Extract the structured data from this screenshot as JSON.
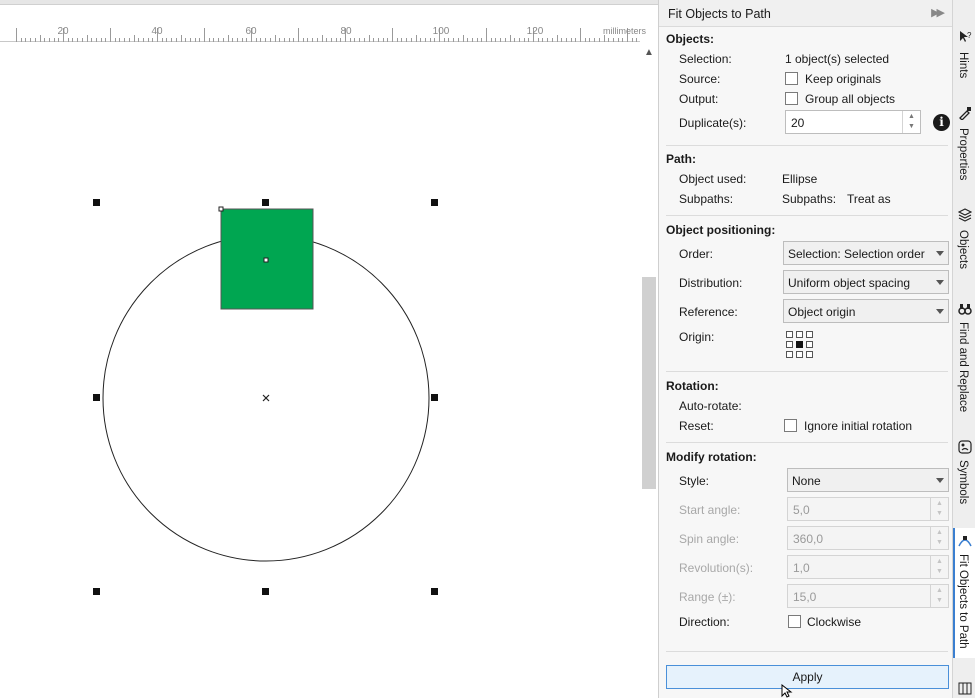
{
  "ruler": {
    "labels": [
      "20",
      "40",
      "60",
      "80",
      "100",
      "120"
    ],
    "unit": "millimeters"
  },
  "docker": {
    "title": "Fit Objects to Path",
    "objects": {
      "heading": "Objects:",
      "selection_label": "Selection:",
      "selection_value": "1 object(s) selected",
      "source_label": "Source:",
      "keep_originals": "Keep originals",
      "output_label": "Output:",
      "group_all": "Group all objects",
      "duplicates_label": "Duplicate(s):",
      "duplicates_value": "20"
    },
    "path": {
      "heading": "Path:",
      "object_used_label": "Object used:",
      "object_used_value": "Ellipse",
      "subpaths_label": "Subpaths:",
      "subpaths_value1": "Subpaths:",
      "subpaths_value2": "Treat as"
    },
    "positioning": {
      "heading": "Object positioning:",
      "order_label": "Order:",
      "order_value": "Selection: Selection order",
      "distribution_label": "Distribution:",
      "distribution_value": "Uniform object spacing",
      "reference_label": "Reference:",
      "reference_value": "Object origin",
      "origin_label": "Origin:"
    },
    "rotation": {
      "heading": "Rotation:",
      "auto_rotate_label": "Auto-rotate:",
      "reset_label": "Reset:",
      "ignore_initial": "Ignore initial rotation"
    },
    "modify_rotation": {
      "heading": "Modify rotation:",
      "style_label": "Style:",
      "style_value": "None",
      "start_angle_label": "Start angle:",
      "start_angle_value": "5,0",
      "spin_angle_label": "Spin angle:",
      "spin_angle_value": "360,0",
      "revolutions_label": "Revolution(s):",
      "revolutions_value": "1,0",
      "range_label": "Range (±):",
      "range_value": "15,0",
      "direction_label": "Direction:",
      "clockwise": "Clockwise"
    },
    "apply_label": "Apply"
  },
  "tabs": [
    {
      "label": "Hints",
      "icon": "hints-icon"
    },
    {
      "label": "Properties",
      "icon": "properties-icon"
    },
    {
      "label": "Objects",
      "icon": "layers-icon"
    },
    {
      "label": "Find and Replace",
      "icon": "binoculars-icon"
    },
    {
      "label": "Symbols",
      "icon": "symbols-icon"
    },
    {
      "label": "Fit Objects to Path",
      "icon": "fit-path-icon"
    }
  ],
  "colors": {
    "square_fill": "#00a651",
    "accent": "#3b7fd0"
  }
}
